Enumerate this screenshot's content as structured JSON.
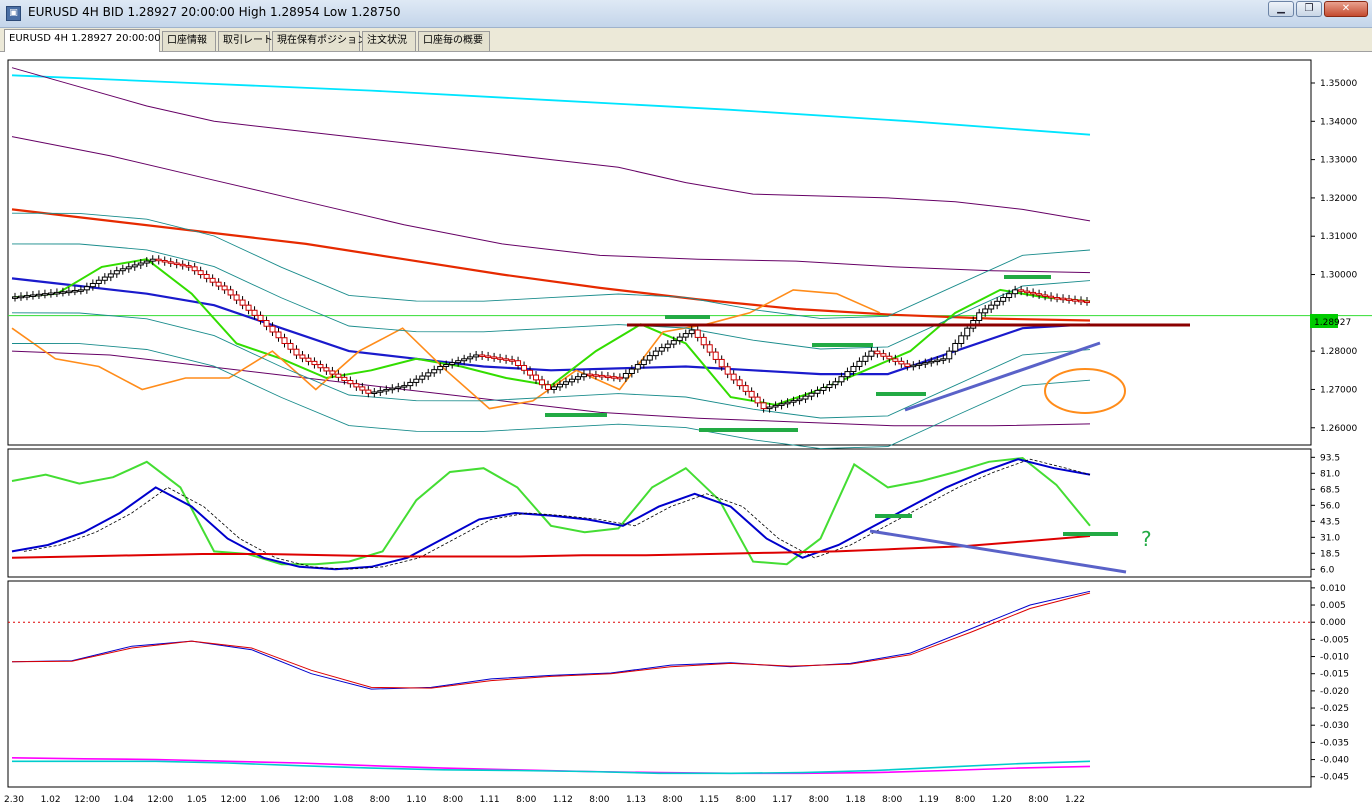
{
  "window": {
    "title": "EURUSD 4H BID 1.28927 20:00:00 High 1.28954 Low 1.28750",
    "buttons": [
      {
        "name": "minimize",
        "glyph": "▁"
      },
      {
        "name": "restore",
        "glyph": "❐"
      },
      {
        "name": "close",
        "glyph": "✕"
      }
    ]
  },
  "tabs": [
    {
      "label": "EURUSD 4H 1.28927 20:00:00",
      "active": true
    },
    {
      "label": "口座情報"
    },
    {
      "label": "取引レート"
    },
    {
      "label": "現在保有ポジション"
    },
    {
      "label": "注文状況"
    },
    {
      "label": "口座毎の概要"
    }
  ],
  "chart_data": [
    {
      "type": "line",
      "symbol": "EURUSD 4H",
      "ylim": [
        1.2555,
        1.356
      ],
      "price_ticks": [
        "1.35000",
        "1.34000",
        "1.33000",
        "1.32000",
        "1.31000",
        "1.30000",
        "1.28000",
        "1.27000",
        "1.26000"
      ],
      "current_price_label": "1.28927",
      "current_price": 1.28927,
      "series": [
        {
          "role": "close",
          "color": "#000000",
          "values": [
            1.294,
            1.295,
            1.296,
            1.301,
            1.304,
            1.302,
            1.296,
            1.288,
            1.279,
            1.274,
            1.269,
            1.271,
            1.276,
            1.279,
            1.2775,
            1.27,
            1.274,
            1.273,
            1.28,
            1.2855,
            1.274,
            1.265,
            1.2675,
            1.272,
            1.28,
            1.276,
            1.278,
            1.29,
            1.296,
            1.294,
            1.2929
          ]
        },
        {
          "role": "ma-cyan",
          "color": "#00e5ff",
          "values": [
            1.352,
            1.35,
            1.348,
            1.3455,
            1.343,
            1.34,
            1.3365
          ]
        },
        {
          "role": "ma-purple-1",
          "color": "#660066",
          "values": [
            1.354,
            1.349,
            1.344,
            1.34,
            1.338,
            1.336,
            1.334,
            1.332,
            1.33,
            1.328,
            1.324,
            1.321,
            1.3205,
            1.32,
            1.319,
            1.317,
            1.314
          ]
        },
        {
          "role": "ma-purple-2",
          "color": "#660066",
          "values": [
            1.336,
            1.331,
            1.325,
            1.319,
            1.313,
            1.308,
            1.305,
            1.304,
            1.3035,
            1.302,
            1.301,
            1.3005
          ]
        },
        {
          "role": "ma-purple-3",
          "color": "#660066",
          "values": [
            1.28,
            1.279,
            1.276,
            1.273,
            1.27,
            1.267,
            1.264,
            1.2625,
            1.2615,
            1.2605,
            1.2605,
            1.261
          ]
        },
        {
          "role": "ma-red",
          "color": "#e62a00",
          "values": [
            1.317,
            1.314,
            1.311,
            1.308,
            1.304,
            1.3,
            1.2965,
            1.2935,
            1.291,
            1.2895,
            1.2885,
            1.288
          ]
        },
        {
          "role": "ma-blue",
          "color": "#1a1acc",
          "values": [
            1.299,
            1.297,
            1.295,
            1.292,
            1.286,
            1.28,
            1.278,
            1.276,
            1.275,
            1.2755,
            1.276,
            1.275,
            1.274,
            1.274,
            1.28,
            1.286,
            1.287
          ]
        },
        {
          "role": "ma-green",
          "color": "#33dd00",
          "values": [
            1.294,
            1.295,
            1.302,
            1.304,
            1.295,
            1.282,
            1.278,
            1.273,
            1.275,
            1.278,
            1.276,
            1.273,
            1.271,
            1.28,
            1.287,
            1.282,
            1.268,
            1.266,
            1.27,
            1.275,
            1.28,
            1.29,
            1.296,
            1.294,
            1.293
          ]
        },
        {
          "role": "chikou-orange",
          "color": "#ff8c1a",
          "values": [
            1.286,
            1.278,
            1.276,
            1.27,
            1.273,
            1.273,
            1.28,
            1.27,
            1.28,
            1.286,
            1.275,
            1.265,
            1.267,
            1.275,
            1.27,
            1.285,
            1.287,
            1.29,
            1.296,
            1.295,
            1.29
          ]
        }
      ]
    },
    {
      "type": "line",
      "ylim": [
        0,
        100
      ],
      "ticks": [
        "93.5",
        "81.0",
        "68.5",
        "56.0",
        "43.5",
        "31.0",
        "18.5",
        "6.0"
      ],
      "annotation": "?",
      "series": [
        {
          "role": "stoch-main",
          "color": "#44dd33",
          "values": [
            75,
            80,
            73,
            78,
            90,
            70,
            20,
            18,
            10,
            10,
            12,
            20,
            60,
            82,
            85,
            70,
            40,
            35,
            38,
            70,
            85,
            60,
            12,
            10,
            30,
            88,
            70,
            75,
            82,
            90,
            93,
            72,
            40
          ]
        },
        {
          "role": "stoch-signal",
          "color": "#0000cc",
          "values": [
            20,
            25,
            35,
            50,
            70,
            55,
            30,
            15,
            8,
            6,
            8,
            15,
            30,
            45,
            50,
            48,
            45,
            40,
            55,
            65,
            55,
            30,
            15,
            25,
            40,
            55,
            70,
            82,
            92,
            85,
            80
          ]
        },
        {
          "role": "rsi-red",
          "color": "#dd0000",
          "values": [
            15,
            16,
            17,
            18,
            18,
            17,
            16,
            16,
            16,
            17,
            17,
            18,
            19,
            20,
            22,
            24,
            28,
            32
          ]
        }
      ]
    },
    {
      "type": "line",
      "ylim": [
        -0.048,
        0.012
      ],
      "ticks": [
        "0.010",
        "0.005",
        "0.000",
        "-0.005",
        "-0.010",
        "-0.015",
        "-0.020",
        "-0.025",
        "-0.030",
        "-0.035",
        "-0.040",
        "-0.045"
      ],
      "series": [
        {
          "role": "macd-blue",
          "color": "#0000cc",
          "values": [
            -0.0115,
            -0.0112,
            -0.007,
            -0.0055,
            -0.008,
            -0.015,
            -0.0195,
            -0.019,
            -0.0165,
            -0.0155,
            -0.0148,
            -0.0125,
            -0.0118,
            -0.013,
            -0.012,
            -0.009,
            -0.002,
            0.005,
            0.009
          ]
        },
        {
          "role": "macd-red",
          "color": "#dd0000",
          "values": [
            -0.0115,
            -0.0114,
            -0.0075,
            -0.0055,
            -0.0075,
            -0.014,
            -0.019,
            -0.0192,
            -0.017,
            -0.0158,
            -0.015,
            -0.013,
            -0.012,
            -0.0128,
            -0.0122,
            -0.0095,
            -0.003,
            0.004,
            0.0085
          ]
        },
        {
          "role": "magenta",
          "color": "#ff00ff",
          "values": [
            -0.0395,
            -0.0398,
            -0.04,
            -0.0405,
            -0.041,
            -0.0418,
            -0.0425,
            -0.043,
            -0.0435,
            -0.0438,
            -0.044,
            -0.044,
            -0.0438,
            -0.0432,
            -0.0425,
            -0.042
          ]
        },
        {
          "role": "cyan",
          "color": "#00cccc",
          "values": [
            -0.0405,
            -0.0405,
            -0.0405,
            -0.041,
            -0.0418,
            -0.0425,
            -0.043,
            -0.0432,
            -0.0435,
            -0.044,
            -0.044,
            -0.0438,
            -0.0432,
            -0.0422,
            -0.0412,
            -0.0405
          ]
        }
      ]
    }
  ],
  "time_axis": [
    "2.30",
    "1.02",
    "12:00",
    "1.04",
    "12:00",
    "1.05",
    "12:00",
    "1.06",
    "12:00",
    "1.08",
    "8:00",
    "1.10",
    "8:00",
    "1.11",
    "8:00",
    "1.12",
    "8:00",
    "1.13",
    "8:00",
    "1.15",
    "8:00",
    "1.17",
    "8:00",
    "1.18",
    "8:00",
    "1.19",
    "8:00",
    "1.20",
    "8:00",
    "1.22"
  ]
}
